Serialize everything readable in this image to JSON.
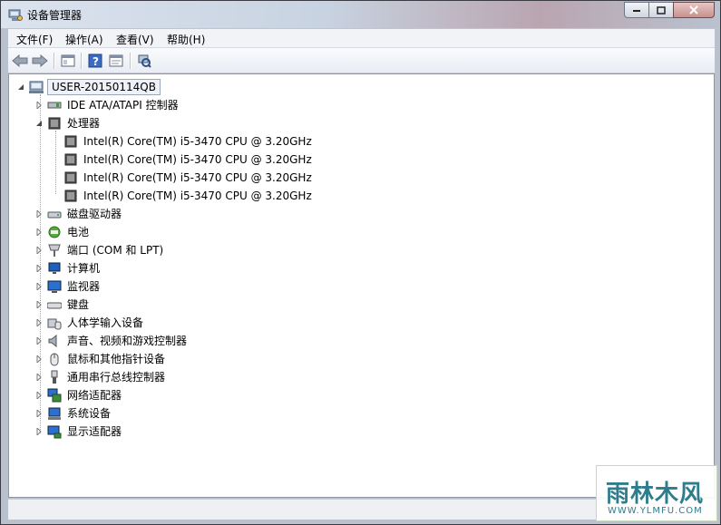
{
  "window": {
    "title": "设备管理器"
  },
  "menu": [
    {
      "label": "文件(F)"
    },
    {
      "label": "操作(A)"
    },
    {
      "label": "查看(V)"
    },
    {
      "label": "帮助(H)"
    }
  ],
  "toolbar": {
    "icons": [
      "back-arrow-icon",
      "forward-arrow-icon",
      "show-hide-console-tree-icon",
      "help-icon",
      "properties-icon",
      "scan-hardware-icon"
    ]
  },
  "tree": {
    "root": {
      "label": "USER-20150114QB",
      "icon": "computer-icon"
    },
    "items": [
      {
        "label": "IDE ATA/ATAPI 控制器",
        "icon": "ide-controller-icon",
        "expanded": false
      },
      {
        "label": "处理器",
        "icon": "processor-icon",
        "expanded": true,
        "children": [
          {
            "label": "Intel(R) Core(TM) i5-3470 CPU @ 3.20GHz"
          },
          {
            "label": "Intel(R) Core(TM) i5-3470 CPU @ 3.20GHz"
          },
          {
            "label": "Intel(R) Core(TM) i5-3470 CPU @ 3.20GHz"
          },
          {
            "label": "Intel(R) Core(TM) i5-3470 CPU @ 3.20GHz"
          }
        ]
      },
      {
        "label": "磁盘驱动器",
        "icon": "disk-drive-icon",
        "expanded": false
      },
      {
        "label": "电池",
        "icon": "battery-icon",
        "expanded": false
      },
      {
        "label": "端口 (COM 和 LPT)",
        "icon": "port-icon",
        "expanded": false
      },
      {
        "label": "计算机",
        "icon": "computer-icon",
        "expanded": false
      },
      {
        "label": "监视器",
        "icon": "monitor-icon",
        "expanded": false
      },
      {
        "label": "键盘",
        "icon": "keyboard-icon",
        "expanded": false
      },
      {
        "label": "人体学输入设备",
        "icon": "hid-icon",
        "expanded": false
      },
      {
        "label": "声音、视频和游戏控制器",
        "icon": "speaker-icon",
        "expanded": false
      },
      {
        "label": "鼠标和其他指针设备",
        "icon": "mouse-icon",
        "expanded": false
      },
      {
        "label": "通用串行总线控制器",
        "icon": "usb-icon",
        "expanded": false
      },
      {
        "label": "网络适配器",
        "icon": "network-adapter-icon",
        "expanded": false
      },
      {
        "label": "系统设备",
        "icon": "system-devices-icon",
        "expanded": false
      },
      {
        "label": "显示适配器",
        "icon": "display-adapter-icon",
        "expanded": false
      }
    ]
  },
  "watermark": {
    "text": "雨林木风",
    "url": "WWW.YLMFU.COM"
  }
}
